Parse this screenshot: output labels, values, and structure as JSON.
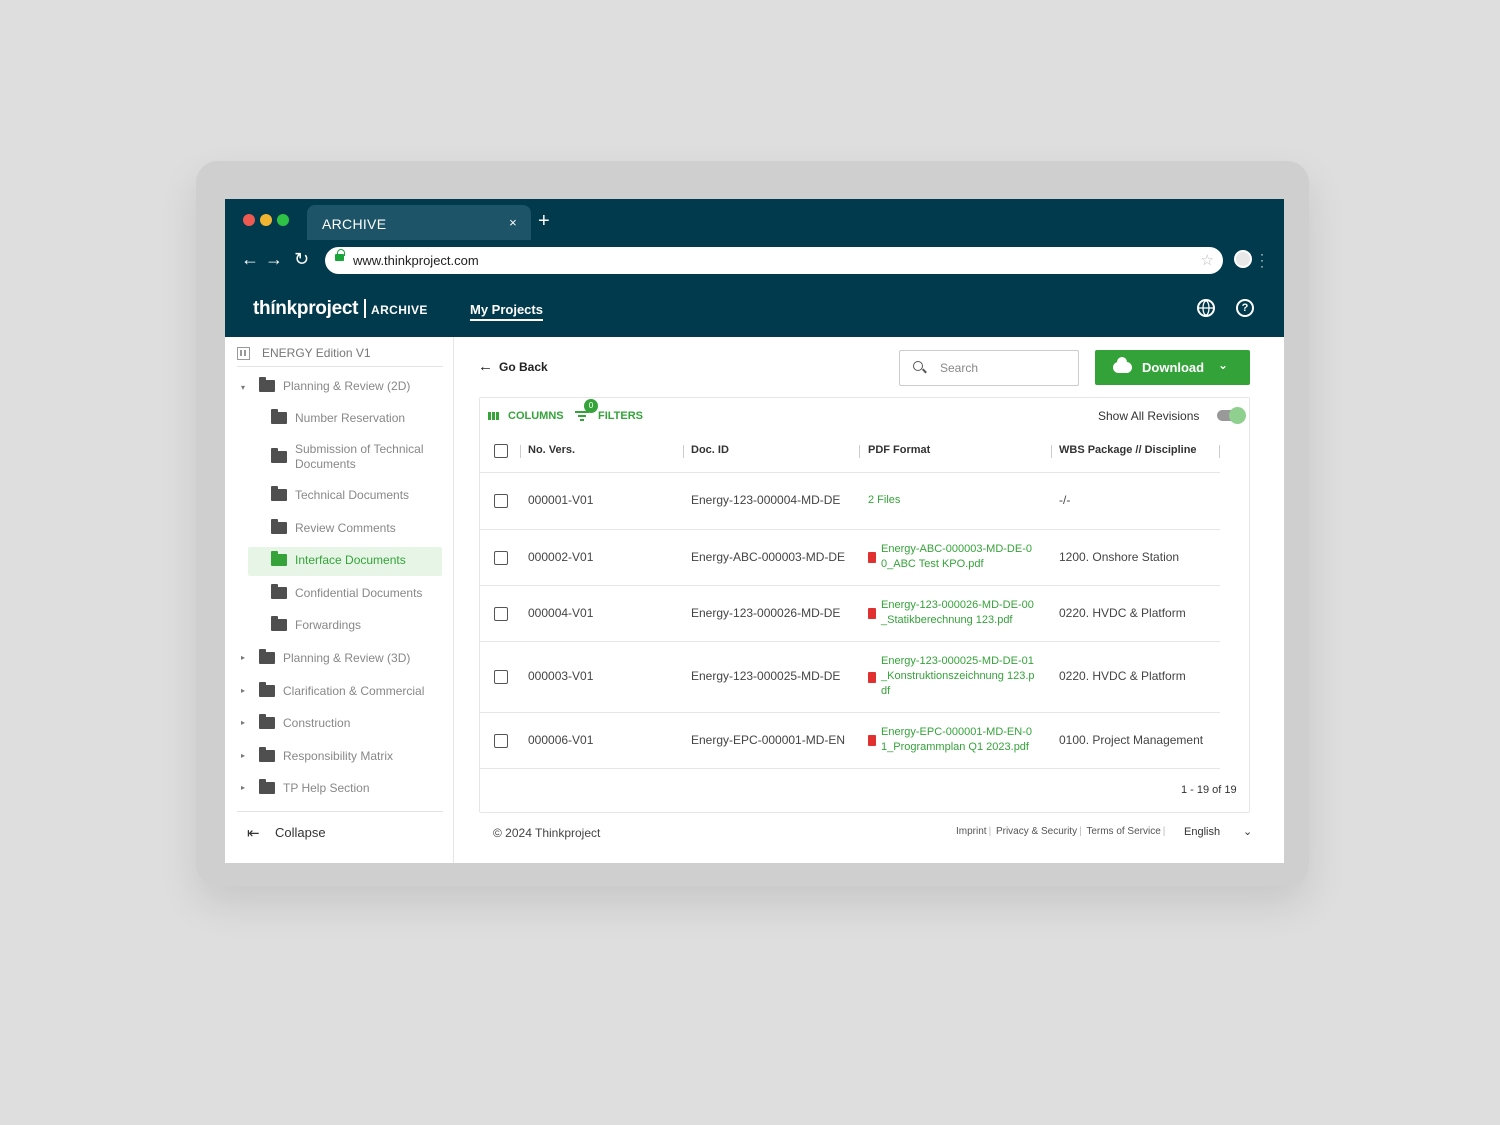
{
  "browser": {
    "tab_title": "ARCHIVE",
    "tab_close": "×",
    "new_tab": "+",
    "url": "www.thinkproject.com",
    "dots": [
      "#ee5a52",
      "#f2b531",
      "#2fc345"
    ]
  },
  "app": {
    "brand": "thínkproject",
    "brand_sub": "ARCHIVE",
    "nav_my_projects": "My Projects",
    "help_glyph": "?"
  },
  "sidebar": {
    "project": "ENERGY Edition V1",
    "items": [
      {
        "label": "Planning & Review (2D)",
        "level": 0,
        "caret": "▾"
      },
      {
        "label": "Number Reservation",
        "level": 1
      },
      {
        "label": "Submission of Technical Documents",
        "level": 1
      },
      {
        "label": "Technical Documents",
        "level": 1
      },
      {
        "label": "Review Comments",
        "level": 1
      },
      {
        "label": "Interface Documents",
        "level": 1,
        "active": true
      },
      {
        "label": "Confidential Documents",
        "level": 1
      },
      {
        "label": "Forwardings",
        "level": 1
      },
      {
        "label": "Planning & Review (3D)",
        "level": 0,
        "caret": "▸"
      },
      {
        "label": "Clarification & Commercial",
        "level": 0,
        "caret": "▸"
      },
      {
        "label": "Construction",
        "level": 0,
        "caret": "▸"
      },
      {
        "label": "Responsibility Matrix",
        "level": 0,
        "caret": "▸"
      },
      {
        "label": "TP Help Section",
        "level": 0,
        "caret": "▸"
      }
    ],
    "collapse": "Collapse"
  },
  "toolbar": {
    "go_back": "Go Back",
    "search_placeholder": "Search",
    "download": "Download"
  },
  "table": {
    "columns_label": "COLUMNS",
    "filters_label": "FILTERS",
    "filters_count": "0",
    "show_all_revisions": "Show All Revisions",
    "headers": [
      "No. Vers.",
      "Doc. ID",
      "PDF Format",
      "WBS Package // Discipline"
    ],
    "rows": [
      {
        "no": "000001-V01",
        "doc": "Energy-123-000004-MD-DE",
        "pdf": [
          "2 Files"
        ],
        "pdf_icon": false,
        "wbs": "-/-"
      },
      {
        "no": "000002-V01",
        "doc": "Energy-ABC-000003-MD-DE",
        "pdf": [
          "Energy-ABC-000003-MD-DE-0",
          "0_ABC Test KPO.pdf"
        ],
        "pdf_icon": true,
        "wbs": "1200. Onshore Station"
      },
      {
        "no": "000004-V01",
        "doc": "Energy-123-000026-MD-DE",
        "pdf": [
          "Energy-123-000026-MD-DE-00",
          "_Statikberechnung 123.pdf"
        ],
        "pdf_icon": true,
        "wbs": "0220. HVDC & Platform"
      },
      {
        "no": "000003-V01",
        "doc": "Energy-123-000025-MD-DE",
        "pdf": [
          "Energy-123-000025-MD-DE-01",
          "_Konstruktionszeichnung 123.p",
          "df"
        ],
        "pdf_icon": true,
        "wbs": "0220. HVDC & Platform"
      },
      {
        "no": "000006-V01",
        "doc": "Energy-EPC-000001-MD-EN",
        "pdf": [
          "Energy-EPC-000001-MD-EN-0",
          "1_Programmplan Q1 2023.pdf"
        ],
        "pdf_icon": true,
        "wbs": "0100. Project Management"
      }
    ],
    "pagination": "1 - 19 of 19"
  },
  "footer": {
    "copyright": "© 2024 Thinkproject",
    "links": [
      "Imprint",
      "Privacy & Security",
      "Terms of Service"
    ],
    "language": "English"
  },
  "colors": {
    "chrome": "#013a4c",
    "accent": "#35a33a",
    "pdf_icon": "#e03030"
  }
}
